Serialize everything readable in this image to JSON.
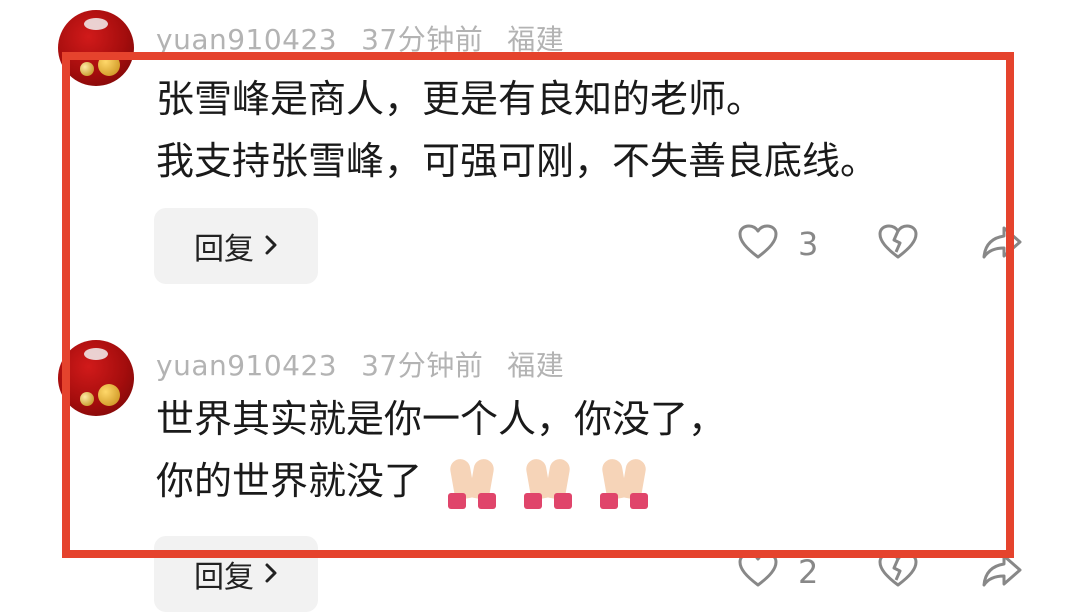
{
  "comments": [
    {
      "username": "yuan910423",
      "time": "37分钟前",
      "location": "福建",
      "lines": [
        "张雪峰是商人，更是有良知的老师。",
        "我支持张雪峰，可强可刚，不失善良底线。"
      ],
      "reply_label": "回复",
      "like_count": "3"
    },
    {
      "username": "yuan910423",
      "time": "37分钟前",
      "location": "福建",
      "lines": [
        "世界其实就是你一个人，你没了，",
        "你的世界就没了"
      ],
      "emoji": "🙏🏻🙏🏻🙏🏻",
      "reply_label": "回复",
      "like_count": "2"
    }
  ],
  "icons": {
    "avatar": "avatar-christmas-ornaments",
    "reply_chevron": "chevron-right-icon",
    "like": "heart-outline-icon",
    "dislike": "broken-heart-icon",
    "share": "share-arrow-icon"
  },
  "colors": {
    "highlight_border": "#e5432d",
    "meta_text": "#b3b3b3",
    "reply_bg": "#f2f2f2"
  }
}
